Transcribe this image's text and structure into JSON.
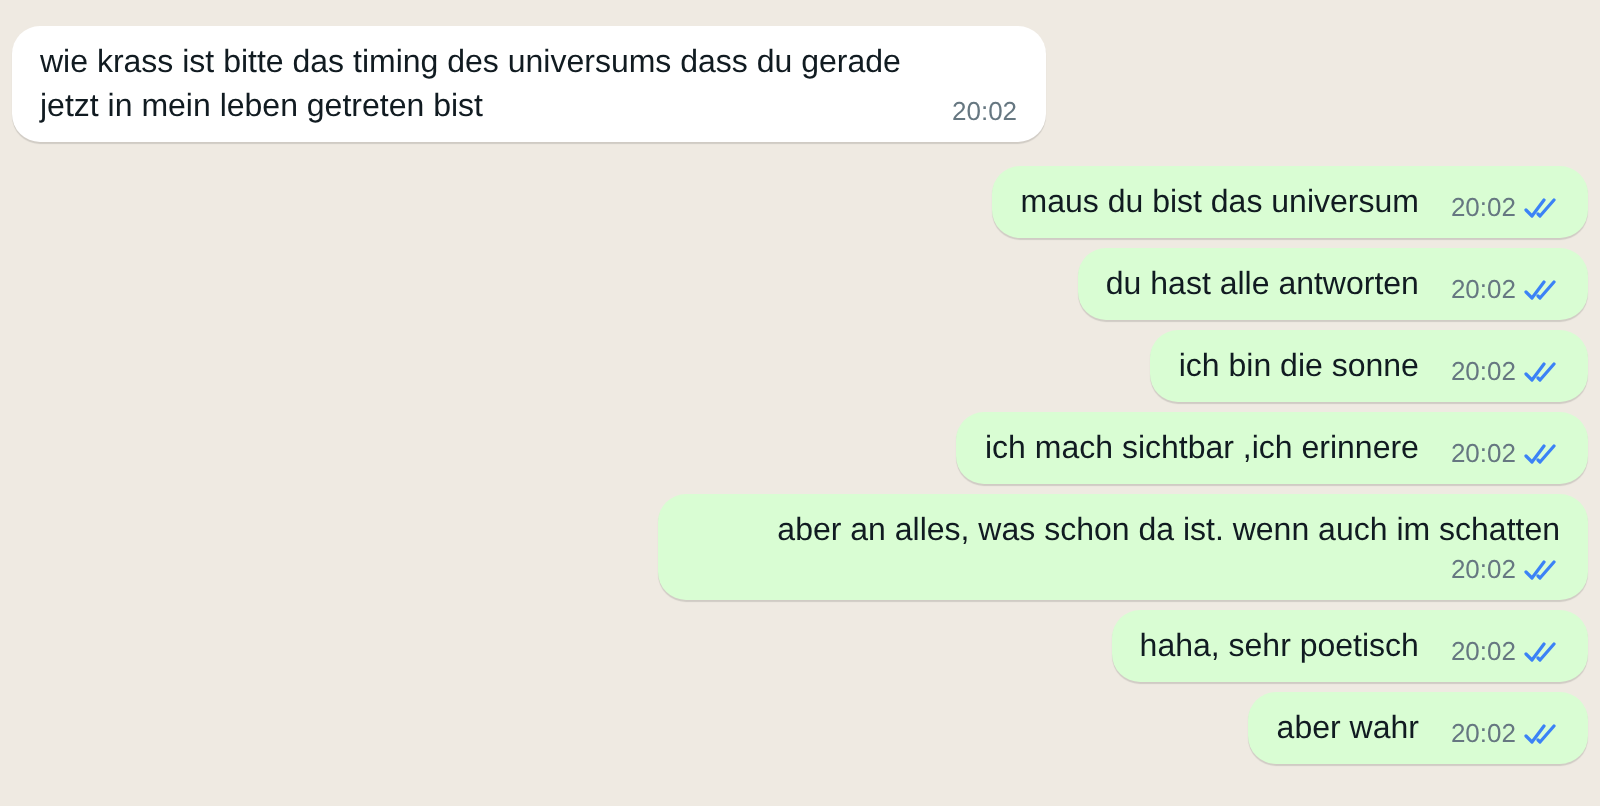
{
  "messages": [
    {
      "kind": "incoming",
      "text": "wie krass ist bitte das timing des universums dass du gerade jetzt in mein leben getreten bist",
      "time": "20:02"
    },
    {
      "kind": "outgoing",
      "text": "maus du bist das universum",
      "time": "20:02",
      "read": true
    },
    {
      "kind": "outgoing",
      "text": "du hast alle antworten",
      "time": "20:02",
      "read": true
    },
    {
      "kind": "outgoing",
      "text": "ich bin die sonne",
      "time": "20:02",
      "read": true
    },
    {
      "kind": "outgoing",
      "text": "ich mach sichtbar ,ich erinnere",
      "time": "20:02",
      "read": true
    },
    {
      "kind": "outgoing",
      "text": "aber an alles, was schon da ist. wenn auch im schatten",
      "time": "20:02",
      "read": true
    },
    {
      "kind": "outgoing",
      "text": "haha, sehr poetisch",
      "time": "20:02",
      "read": true
    },
    {
      "kind": "outgoing",
      "text": "aber wahr",
      "time": "20:02",
      "read": true
    }
  ]
}
